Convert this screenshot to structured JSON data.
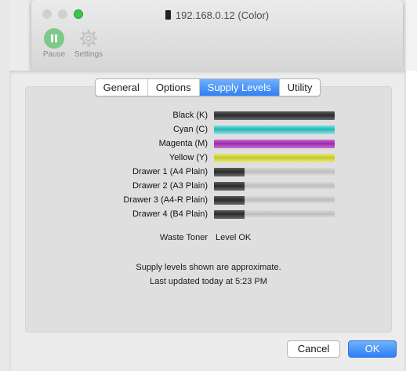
{
  "window": {
    "title": "192.168.0.12 (Color)"
  },
  "toolbar": {
    "pause_label": "Pause",
    "settings_label": "Settings"
  },
  "tabs": [
    {
      "label": "General"
    },
    {
      "label": "Options"
    },
    {
      "label": "Supply Levels",
      "active": true
    },
    {
      "label": "Utility"
    }
  ],
  "supplies": [
    {
      "label": "Black (K)",
      "level": 1.0,
      "color": "black"
    },
    {
      "label": "Cyan (C)",
      "level": 1.0,
      "color": "cyan"
    },
    {
      "label": "Magenta (M)",
      "level": 1.0,
      "color": "magenta"
    },
    {
      "label": "Yellow (Y)",
      "level": 1.0,
      "color": "yellow"
    },
    {
      "label": "Drawer 1 (A4 Plain)",
      "level": 0.25,
      "color": "black"
    },
    {
      "label": "Drawer 2 (A3 Plain)",
      "level": 0.25,
      "color": "black"
    },
    {
      "label": "Drawer 3 (A4-R Plain)",
      "level": 0.25,
      "color": "black"
    },
    {
      "label": "Drawer 4 (B4 Plain)",
      "level": 0.25,
      "color": "black"
    }
  ],
  "waste_toner": {
    "label": "Waste Toner",
    "value": "Level OK"
  },
  "notes": {
    "approx": "Supply levels shown are approximate.",
    "updated": "Last updated today at 5:23 PM"
  },
  "buttons": {
    "cancel": "Cancel",
    "ok": "OK"
  },
  "colors": {
    "accent": "#2f7ff6",
    "cyan": "#28b4b4",
    "magenta": "#9a2aa8",
    "yellow": "#c5c92a",
    "black": "#2b2b2b"
  }
}
